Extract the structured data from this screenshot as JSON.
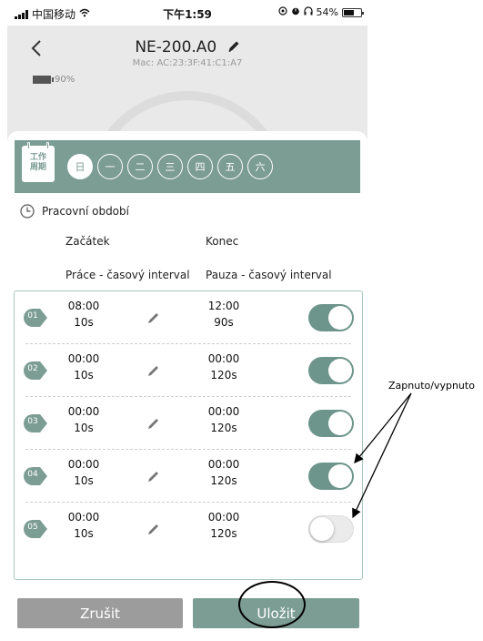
{
  "status_bar": {
    "carrier": "中国移动",
    "time": "下午1:59",
    "battery": "54%"
  },
  "header": {
    "title": "NE-200.A0",
    "mac_label": "Mac:",
    "mac": "AC:23:3F:41:C1:A7",
    "device_battery": "90%"
  },
  "schedule": {
    "calendar_label_line1": "工作",
    "calendar_label_line2": "周期",
    "days": [
      "日",
      "一",
      "二",
      "三",
      "四",
      "五",
      "六"
    ],
    "active_day": "日",
    "period_label": "Pracovní období",
    "start_header": "Začátek",
    "end_header": "Konec",
    "work_header": "Práce - časový interval",
    "pause_header": "Pauza - časový interval",
    "rows": [
      {
        "num": "01",
        "start": "08:00",
        "work": "10s",
        "end": "12:00",
        "pause": "90s",
        "enabled": true
      },
      {
        "num": "02",
        "start": "00:00",
        "work": "10s",
        "end": "00:00",
        "pause": "120s",
        "enabled": true
      },
      {
        "num": "03",
        "start": "00:00",
        "work": "10s",
        "end": "00:00",
        "pause": "120s",
        "enabled": true
      },
      {
        "num": "04",
        "start": "00:00",
        "work": "10s",
        "end": "00:00",
        "pause": "120s",
        "enabled": true
      },
      {
        "num": "05",
        "start": "00:00",
        "work": "10s",
        "end": "00:00",
        "pause": "120s",
        "enabled": false
      }
    ]
  },
  "buttons": {
    "cancel": "Zrušit",
    "save": "Uložit"
  },
  "annotation": {
    "text": "Zapnuto/vypnuto"
  },
  "colors": {
    "accent": "#7c9d94",
    "toggle_on": "#6e958b",
    "cancel": "#9c9c9c"
  }
}
